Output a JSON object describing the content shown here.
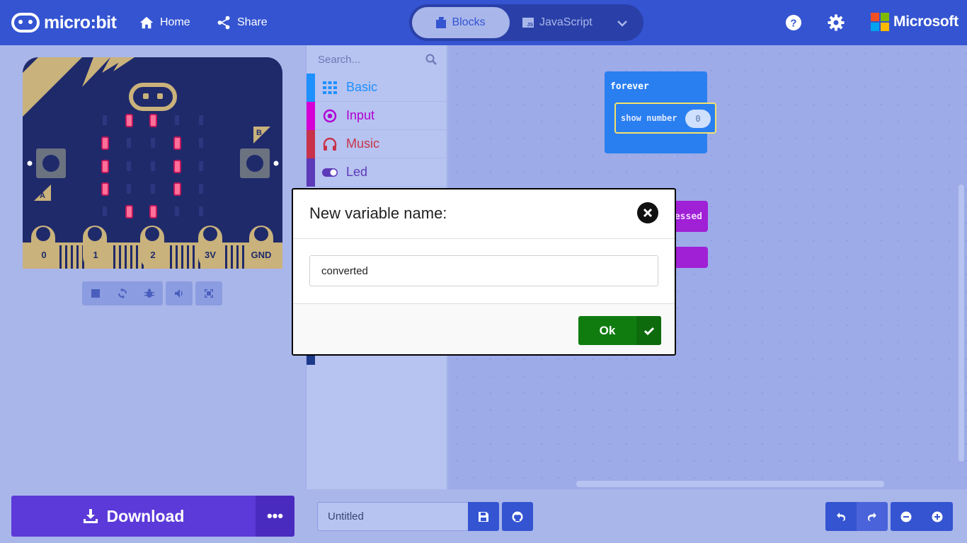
{
  "header": {
    "logo_text": "micro:bit",
    "home_label": "Home",
    "share_label": "Share",
    "blocks_label": "Blocks",
    "javascript_label": "JavaScript",
    "js_badge": "JS",
    "microsoft_label": "Microsoft"
  },
  "simulator": {
    "pin_labels": [
      "0",
      "1",
      "2",
      "3V",
      "GND"
    ],
    "button_a": "A",
    "button_b": "B",
    "led_on": [
      [
        1,
        1
      ],
      [
        1,
        2
      ],
      [
        2,
        0
      ],
      [
        2,
        3
      ],
      [
        3,
        0
      ],
      [
        3,
        3
      ],
      [
        4,
        0
      ],
      [
        4,
        3
      ],
      [
        5,
        1
      ],
      [
        5,
        2
      ]
    ]
  },
  "toolbox": {
    "search_placeholder": "Search...",
    "categories": [
      {
        "label": "Basic",
        "color": "#1e90ff",
        "icon": "grid-icon"
      },
      {
        "label": "Input",
        "color": "#d400d4",
        "icon": "radio-icon"
      },
      {
        "label": "Music",
        "color": "#e63022",
        "icon": "headphones-icon"
      },
      {
        "label": "Led",
        "color": "#5c2d91",
        "icon": "toggle-icon"
      }
    ]
  },
  "workspace": {
    "forever_label": "forever",
    "show_number_label": "show number",
    "show_number_value": "0",
    "pressed_partial": "essed"
  },
  "footer": {
    "download_label": "Download",
    "more_label": "•••",
    "project_name": "Untitled"
  },
  "modal": {
    "title": "New variable name:",
    "input_value": "converted",
    "ok_label": "Ok"
  },
  "colors": {
    "header": "#3454d1",
    "download": "#5c3ad9",
    "ok": "#107c10",
    "board": "#1f2a6b",
    "gold": "#c9b27b"
  }
}
